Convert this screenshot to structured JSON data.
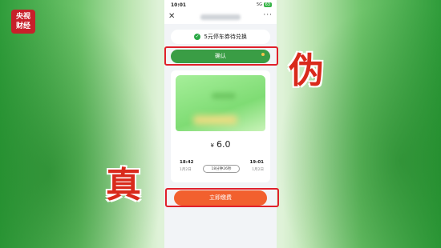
{
  "logo": {
    "line1": "央视",
    "line2": "财经"
  },
  "status": {
    "time": "10:01",
    "signal": "5G",
    "battery": "63"
  },
  "nav": {
    "close": "✕",
    "more": "···"
  },
  "coupon": {
    "label": "5元停车券待兑换"
  },
  "confirm": {
    "label": "确认"
  },
  "ticket": {
    "currency": "¥",
    "amount": "6.0",
    "start_time": "18:42",
    "start_date": "1月2日",
    "end_time": "19:01",
    "end_date": "1月2日",
    "duration": "18分钟26秒"
  },
  "pay": {
    "label": "立即缴费"
  },
  "annotations": {
    "fake": "伪",
    "real": "真"
  },
  "colors": {
    "confirm_green": "#3a9d45",
    "pay_orange": "#f2602e",
    "highlight_red": "#e0202a"
  }
}
